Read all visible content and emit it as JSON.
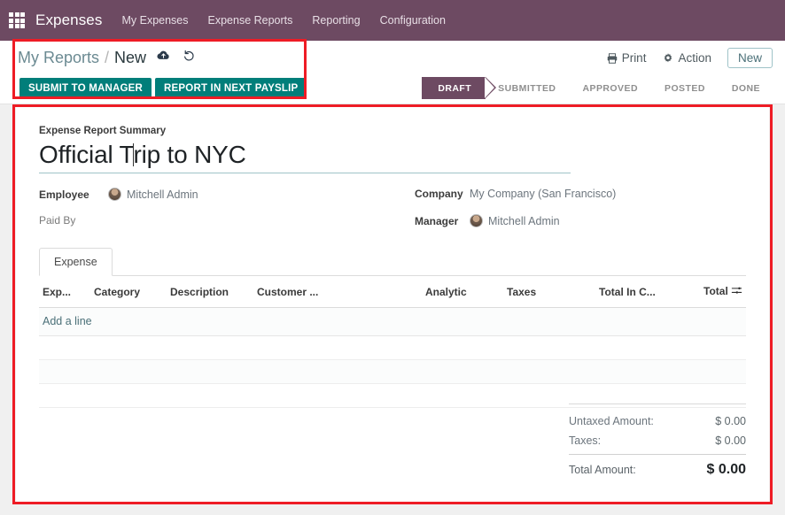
{
  "navbar": {
    "apps_icon": "apps-grid-icon",
    "brand": "Expenses",
    "menu": [
      {
        "label": "My Expenses"
      },
      {
        "label": "Expense Reports"
      },
      {
        "label": "Reporting"
      },
      {
        "label": "Configuration"
      }
    ],
    "background_color": "#6d4a62"
  },
  "control_panel": {
    "breadcrumb": {
      "parent": "My Reports",
      "separator": "/",
      "current": "New"
    },
    "save_icon": "cloud-upload-icon",
    "discard_icon": "undo-arrow-icon",
    "print_label": "Print",
    "print_icon": "printer-icon",
    "action_label": "Action",
    "action_icon": "gear-icon",
    "new_label": "New",
    "buttons": [
      {
        "label": "Submit to Manager",
        "color": "#017e7a"
      },
      {
        "label": "Report in Next Payslip",
        "color": "#017e7a"
      }
    ],
    "statusbar": [
      {
        "label": "Draft",
        "active": true
      },
      {
        "label": "Submitted",
        "active": false
      },
      {
        "label": "Approved",
        "active": false
      },
      {
        "label": "Posted",
        "active": false
      },
      {
        "label": "Done",
        "active": false
      }
    ]
  },
  "form": {
    "summary_label": "Expense Report Summary",
    "summary_value": "Official T",
    "summary_value_rest": "rip to NYC",
    "fields": {
      "employee_label": "Employee",
      "employee_value": "Mitchell Admin",
      "paid_by_label": "Paid By",
      "paid_by_value": "",
      "company_label": "Company",
      "company_value": "My Company (San Francisco)",
      "manager_label": "Manager",
      "manager_value": "Mitchell Admin"
    },
    "notebook": {
      "tabs": [
        {
          "label": "Expense"
        }
      ],
      "columns": [
        {
          "label": "Exp...",
          "align": "left"
        },
        {
          "label": "Category",
          "align": "left"
        },
        {
          "label": "Description",
          "align": "left"
        },
        {
          "label": "Customer ...",
          "align": "left"
        },
        {
          "label": "Analytic",
          "align": "left"
        },
        {
          "label": "Taxes",
          "align": "left"
        },
        {
          "label": "Total In C...",
          "align": "left"
        },
        {
          "label": "Total",
          "align": "right"
        }
      ],
      "column_config_icon": "sliders-icon",
      "add_line_label": "Add a line",
      "rows": []
    },
    "totals": [
      {
        "label": "Untaxed Amount:",
        "value": "$ 0.00",
        "grand": false
      },
      {
        "label": "Taxes:",
        "value": "$ 0.00",
        "grand": false
      },
      {
        "label": "Total Amount:",
        "value": "$ 0.00",
        "grand": true
      }
    ]
  },
  "annotations": {
    "highlight_color": "#ee1c25",
    "boxes": [
      {
        "name": "breadcrumb-and-action-buttons"
      },
      {
        "name": "expense-report-form-sheet"
      }
    ]
  }
}
